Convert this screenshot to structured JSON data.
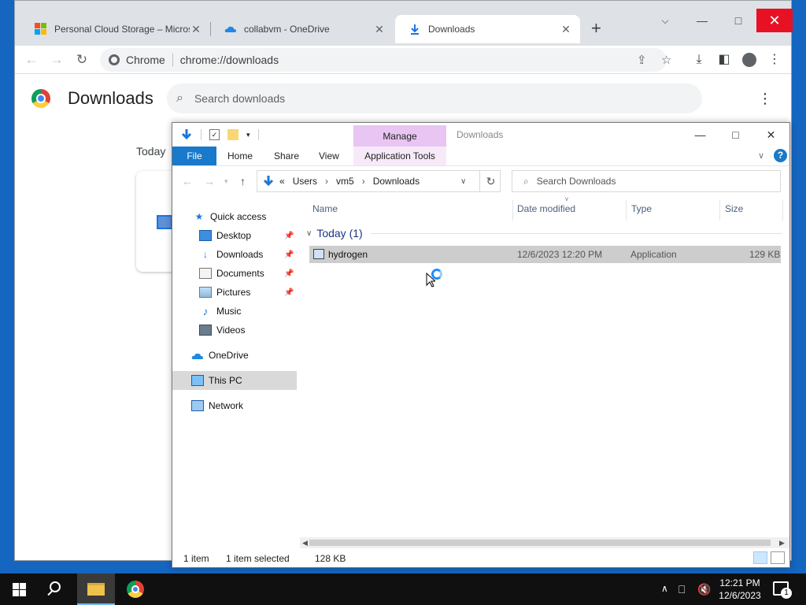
{
  "chrome": {
    "tabs": [
      {
        "title": "Personal Cloud Storage – Micros",
        "close": "✕"
      },
      {
        "title": "collabvm - OneDrive",
        "close": "✕"
      },
      {
        "title": "Downloads",
        "close": "✕"
      }
    ],
    "new_tab": "+",
    "omnibox": {
      "site_label": "Chrome",
      "url": "chrome://downloads"
    },
    "page": {
      "title": "Downloads",
      "search_placeholder": "Search downloads",
      "section_label": "Today"
    }
  },
  "explorer": {
    "title": "Downloads",
    "ribbon_context_tab": "Manage",
    "ribbon_tabs": [
      "File",
      "Home",
      "Share",
      "View",
      "Application Tools"
    ],
    "breadcrumb": [
      "«",
      "Users",
      "vm5",
      "Downloads"
    ],
    "search_placeholder": "Search Downloads",
    "nav": [
      {
        "label": "Quick access"
      },
      {
        "label": "Desktop"
      },
      {
        "label": "Downloads"
      },
      {
        "label": "Documents"
      },
      {
        "label": "Pictures"
      },
      {
        "label": "Music"
      },
      {
        "label": "Videos"
      },
      {
        "label": "OneDrive"
      },
      {
        "label": "This PC"
      },
      {
        "label": "Network"
      }
    ],
    "columns": [
      "Name",
      "Date modified",
      "Type",
      "Size"
    ],
    "group_header": "Today (1)",
    "files": [
      {
        "name": "hydrogen",
        "date_modified": "12/6/2023 12:20 PM",
        "type": "Application",
        "size": "129 KB"
      }
    ],
    "status": {
      "count": "1 item",
      "selection": "1 item selected",
      "size": "128 KB"
    }
  },
  "taskbar": {
    "time": "12:21 PM",
    "date": "12/6/2023",
    "notification_count": "1"
  },
  "colors": {
    "close_red": "#e81123",
    "file_tab_blue": "#1979ca",
    "manage_purple": "#e8c5f2",
    "taskbar": "#101010"
  }
}
